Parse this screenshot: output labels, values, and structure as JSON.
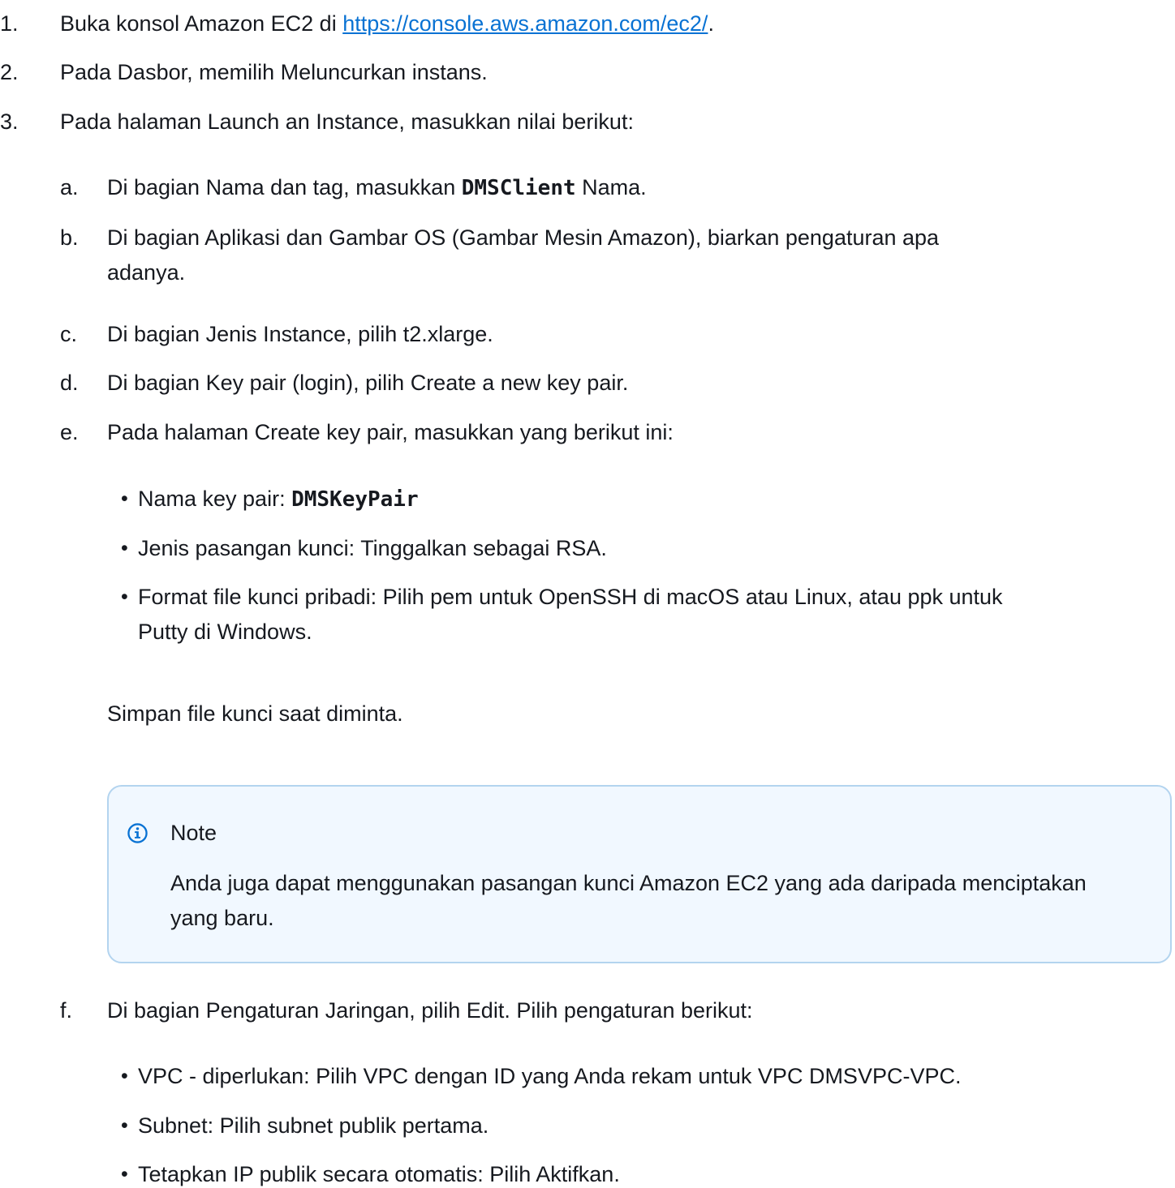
{
  "steps": [
    {
      "num": "1.",
      "before": "Buka konsol Amazon EC2 di ",
      "link": "https://console.aws.amazon.com/ec2/",
      "after": "."
    },
    {
      "num": "2.",
      "text": "Pada Dasbor, memilih Meluncurkan instans."
    },
    {
      "num": "3.",
      "text": "Pada halaman Launch an Instance, masukkan nilai berikut:"
    }
  ],
  "substeps": {
    "a": {
      "label": "a.",
      "before": "Di bagian Nama dan tag, masukkan ",
      "code": "DMSClient",
      "after": " Nama."
    },
    "b": {
      "label": "b.",
      "line1": "Di bagian Aplikasi dan Gambar OS (Gambar Mesin Amazon), biarkan pengaturan apa",
      "line2": "adanya."
    },
    "c": {
      "label": "c.",
      "text": "Di bagian Jenis Instance, pilih t2.xlarge."
    },
    "d": {
      "label": "d.",
      "text": "Di bagian Key pair (login), pilih Create a new key pair."
    },
    "e": {
      "label": "e.",
      "text": "Pada halaman Create key pair, masukkan yang berikut ini:"
    },
    "f": {
      "label": "f.",
      "text": "Di bagian Pengaturan Jaringan, pilih Edit. Pilih pengaturan berikut:"
    }
  },
  "keypair_bullets": {
    "name_label": "Nama key pair: ",
    "name_code": "DMSKeyPair",
    "type": "Jenis pasangan kunci: Tinggalkan sebagai RSA.",
    "format_line1": "Format file kunci pribadi: Pilih pem untuk OpenSSH di macOS atau Linux, atau ppk untuk",
    "format_line2": "Putty di Windows."
  },
  "save_text": "Simpan file kunci saat diminta.",
  "note": {
    "title": "Note",
    "body": "Anda juga dapat menggunakan pasangan kunci Amazon EC2 yang ada daripada menciptakan yang baru."
  },
  "network_bullets": [
    "VPC - diperlukan: Pilih VPC dengan ID yang Anda rekam untuk VPC DMSVPC-VPC.",
    "Subnet: Pilih subnet publik pertama.",
    "Tetapkan IP publik secara otomatis: Pilih Aktifkan."
  ],
  "bullet_char": "•",
  "colors": {
    "text": "#16191f",
    "link": "#0972d3",
    "note_bg": "#f1f8ff",
    "note_border": "#b3d4ef",
    "info_icon": "#0972d3"
  }
}
